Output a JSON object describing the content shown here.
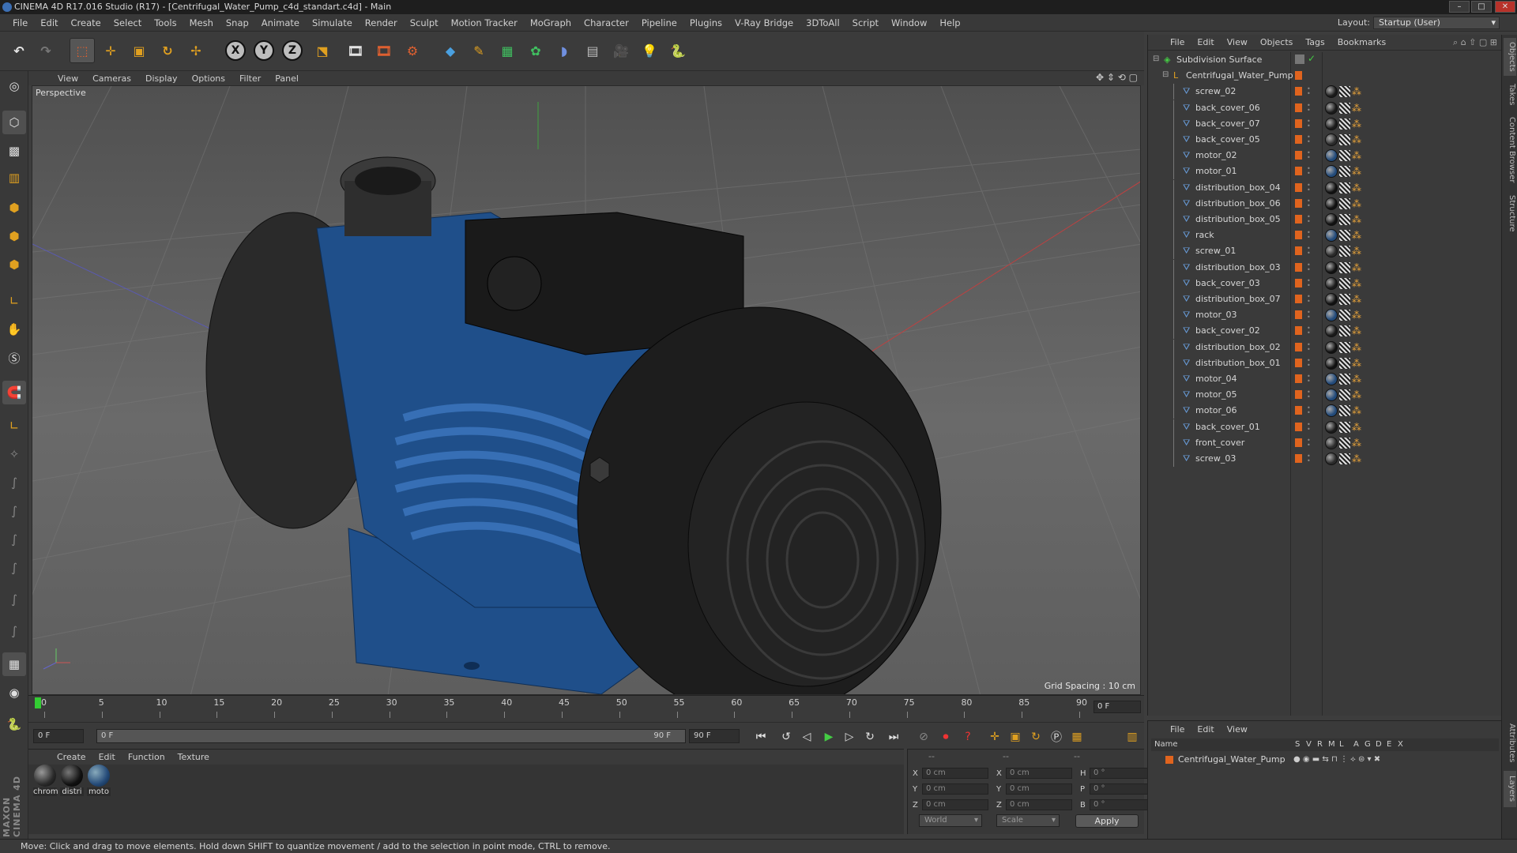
{
  "window": {
    "title": "CINEMA 4D R17.016 Studio (R17) - [Centrifugal_Water_Pump_c4d_standart.c4d] - Main",
    "buttons": [
      "minimize",
      "maximize",
      "close"
    ]
  },
  "menubar": {
    "items": [
      "File",
      "Edit",
      "Create",
      "Select",
      "Tools",
      "Mesh",
      "Snap",
      "Animate",
      "Simulate",
      "Render",
      "Sculpt",
      "Motion Tracker",
      "MoGraph",
      "Character",
      "Pipeline",
      "Plugins",
      "V-Ray Bridge",
      "3DToAll",
      "Script",
      "Window",
      "Help"
    ],
    "layout_label": "Layout:",
    "layout_value": "Startup (User)"
  },
  "toolbar": {
    "icons": [
      "undo-icon",
      "redo-icon",
      "select-icon",
      "move-icon",
      "scale-icon",
      "rotate-icon",
      "live-select-icon",
      "x-axis-icon",
      "y-axis-icon",
      "z-axis-icon",
      "coord-system-icon",
      "render-view-icon",
      "render-picture-viewer-icon",
      "edit-render-settings-icon",
      "cube-icon",
      "pen-icon",
      "subdivision-icon",
      "cloner-icon",
      "deformer-icon",
      "floor-icon",
      "camera-icon",
      "light-icon",
      "python-icon"
    ],
    "axis_labels": [
      "X",
      "Y",
      "Z"
    ]
  },
  "viewport": {
    "menu": [
      "View",
      "Cameras",
      "Display",
      "Options",
      "Filter",
      "Panel"
    ],
    "label": "Perspective",
    "grid_spacing": "Grid Spacing : 10 cm"
  },
  "timeline": {
    "ticks": [
      "0",
      "5",
      "10",
      "15",
      "20",
      "25",
      "30",
      "35",
      "40",
      "45",
      "50",
      "55",
      "60",
      "65",
      "70",
      "75",
      "80",
      "85",
      "90"
    ],
    "current_frame": "0 F",
    "start_field": "0 F",
    "range_start": "0 F",
    "range_end": "90 F",
    "end_field": "90 F"
  },
  "materials": {
    "menu": [
      "Create",
      "Edit",
      "Function",
      "Texture"
    ],
    "items": [
      {
        "label": "chrom",
        "color": "#2a2a2a"
      },
      {
        "label": "distri",
        "color": "#111111"
      },
      {
        "label": "moto",
        "color": "#244a78"
      }
    ]
  },
  "coordinates": {
    "headers": [
      "--",
      "--",
      "--"
    ],
    "rows": [
      {
        "a_label": "X",
        "a_val": "0 cm",
        "b_label": "X",
        "b_val": "0 cm",
        "c_label": "H",
        "c_val": "0 °"
      },
      {
        "a_label": "Y",
        "a_val": "0 cm",
        "b_label": "Y",
        "b_val": "0 cm",
        "c_label": "P",
        "c_val": "0 °"
      },
      {
        "a_label": "Z",
        "a_val": "0 cm",
        "b_label": "Z",
        "b_val": "0 cm",
        "c_label": "B",
        "c_val": "0 °"
      }
    ],
    "space": "World",
    "mode": "Scale",
    "apply": "Apply"
  },
  "objects": {
    "menu": [
      "File",
      "Edit",
      "View",
      "Objects",
      "Tags",
      "Bookmarks"
    ],
    "root": "Subdivision Surface",
    "group": "Centrifugal_Water_Pump",
    "children": [
      "screw_02",
      "back_cover_06",
      "back_cover_07",
      "back_cover_05",
      "motor_02",
      "motor_01",
      "distribution_box_04",
      "distribution_box_06",
      "distribution_box_05",
      "rack",
      "screw_01",
      "distribution_box_03",
      "back_cover_03",
      "distribution_box_07",
      "motor_03",
      "back_cover_02",
      "distribution_box_02",
      "distribution_box_01",
      "motor_04",
      "motor_05",
      "motor_06",
      "back_cover_01",
      "front_cover",
      "screw_03"
    ],
    "tag_colors": [
      "#1a1a1a",
      "#1a1a1a",
      "#1a1a1a",
      "#2a2a2a",
      "#224a7a",
      "#224a7a",
      "#111111",
      "#111111",
      "#111111",
      "#224a7a",
      "#2a2a2a",
      "#111111",
      "#1a1a1a",
      "#111111",
      "#224a7a",
      "#1a1a1a",
      "#111111",
      "#111111",
      "#224a7a",
      "#224a7a",
      "#224a7a",
      "#1a1a1a",
      "#2a2a2a",
      "#2a2a2a"
    ]
  },
  "layers": {
    "menu": [
      "File",
      "Edit",
      "View"
    ],
    "columns": [
      "Name",
      "S",
      "V",
      "R",
      "M",
      "L",
      "A",
      "G",
      "D",
      "E",
      "X"
    ],
    "row": "Centrifugal_Water_Pump"
  },
  "right_tabs": [
    "Objects",
    "Takes",
    "Content Browser",
    "Structure",
    "Attributes",
    "Layers"
  ],
  "status": "Move: Click and drag to move elements. Hold down SHIFT to quantize movement / add to the selection in point mode, CTRL to remove.",
  "left_tools": [
    "make-editable-icon",
    "model-mode-icon",
    "texture-mode-icon",
    "workplane-icon",
    "points-mode-icon",
    "edges-mode-icon",
    "polygons-mode-icon",
    "axis-mode-icon",
    "tweak-icon",
    "snap-icon",
    "magnet-icon",
    "soft-selection-icon",
    "brush-icon",
    "smooth-icon",
    "grab-icon",
    "knife-icon",
    "bridge-icon",
    "extrude-icon",
    "checker-icon",
    "gradient-icon",
    "python-icon"
  ],
  "maxon": "MAXON CINEMA 4D"
}
